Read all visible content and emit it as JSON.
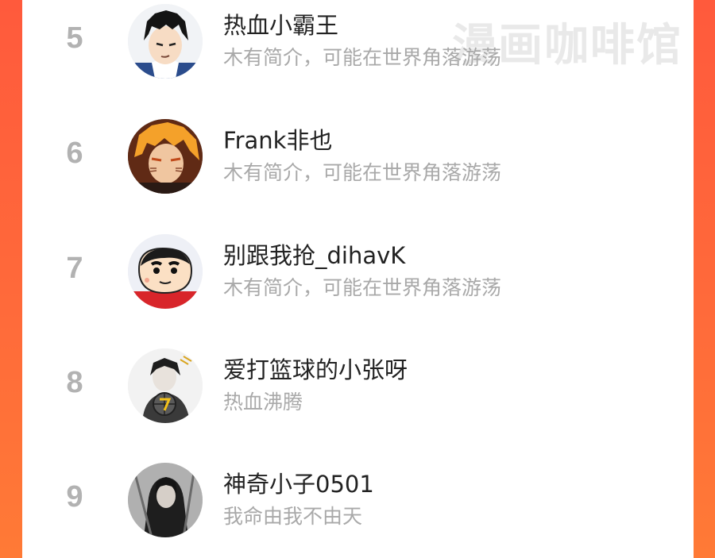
{
  "watermark": "漫画咖啡馆",
  "colors": {
    "accent": "#ff5a3c",
    "rank_text": "#b2b2b2",
    "name_text": "#222222",
    "bio_text": "#a9a9a9"
  },
  "rankings": [
    {
      "rank": "5",
      "name": "热血小霸王",
      "bio": "木有简介，可能在世界角落游荡",
      "avatar": "anime-boy-avatar"
    },
    {
      "rank": "6",
      "name": "Frank非也",
      "bio": "木有简介，可能在世界角落游荡",
      "avatar": "orange-hair-anime-avatar"
    },
    {
      "rank": "7",
      "name": "别跟我抢_dihavK",
      "bio": "木有简介，可能在世界角落游荡",
      "avatar": "crayon-shinchan-avatar"
    },
    {
      "rank": "8",
      "name": "爱打篮球的小张呀",
      "bio": "热血沸腾",
      "avatar": "basketball-sketch-avatar"
    },
    {
      "rank": "9",
      "name": "神奇小子0501",
      "bio": "我命由我不由天",
      "avatar": "dark-portrait-avatar"
    }
  ]
}
